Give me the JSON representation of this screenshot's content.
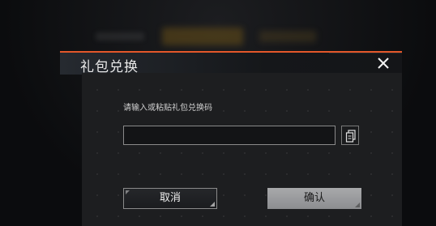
{
  "dialog": {
    "title": "礼包兑换",
    "prompt": "请输入或粘贴礼包兑换码",
    "code_input": {
      "value": "",
      "placeholder": ""
    },
    "cancel_label": "取消",
    "confirm_label": "确认"
  },
  "colors": {
    "accent": "#e4572a",
    "confirm_button": "#9a9b9e",
    "panel": "#1d1e20"
  },
  "icons": {
    "close": "close-icon",
    "paste": "paste-icon"
  }
}
